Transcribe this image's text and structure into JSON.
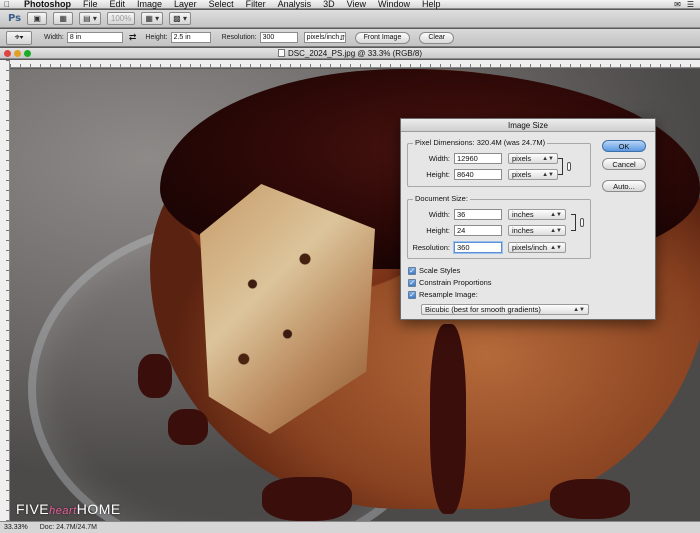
{
  "menubar": {
    "apple_icon": "apple-icon",
    "items": [
      "Photoshop",
      "File",
      "Edit",
      "Image",
      "Layer",
      "Select",
      "Filter",
      "Analysis",
      "3D",
      "View",
      "Window",
      "Help"
    ]
  },
  "appbar": {
    "logo": "Ps",
    "zoom": "100%"
  },
  "options": {
    "width_label": "Width:",
    "width_value": "8 in",
    "height_label": "Height:",
    "height_value": "2.5 in",
    "resolution_label": "Resolution:",
    "resolution_value": "300",
    "resolution_unit": "pixels/inch",
    "front_image": "Front Image",
    "clear": "Clear"
  },
  "document": {
    "title": "DSC_2024_PS.jpg @ 33.3% (RGB/8)"
  },
  "watermark": {
    "part1": "FIVE",
    "part2": "heart",
    "part3": "HOME"
  },
  "status": {
    "zoom": "33.33%",
    "doc_size": "Doc: 24.7M/24.7M"
  },
  "dialog": {
    "title": "Image Size",
    "pixel_dimensions_label": "Pixel Dimensions:",
    "pixel_dimensions_value": "320.4M (was 24.7M)",
    "pixel_width_label": "Width:",
    "pixel_width_value": "12960",
    "pixel_width_unit": "pixels",
    "pixel_height_label": "Height:",
    "pixel_height_value": "8640",
    "pixel_height_unit": "pixels",
    "document_size_label": "Document Size:",
    "doc_width_label": "Width:",
    "doc_width_value": "36",
    "doc_width_unit": "inches",
    "doc_height_label": "Height:",
    "doc_height_value": "24",
    "doc_height_unit": "inches",
    "resolution_label": "Resolution:",
    "resolution_value": "360",
    "resolution_unit": "pixels/inch",
    "scale_styles": "Scale Styles",
    "constrain_proportions": "Constrain Proportions",
    "resample_image": "Resample Image:",
    "resample_method": "Bicubic (best for smooth gradients)",
    "ok": "OK",
    "cancel": "Cancel",
    "auto": "Auto..."
  }
}
